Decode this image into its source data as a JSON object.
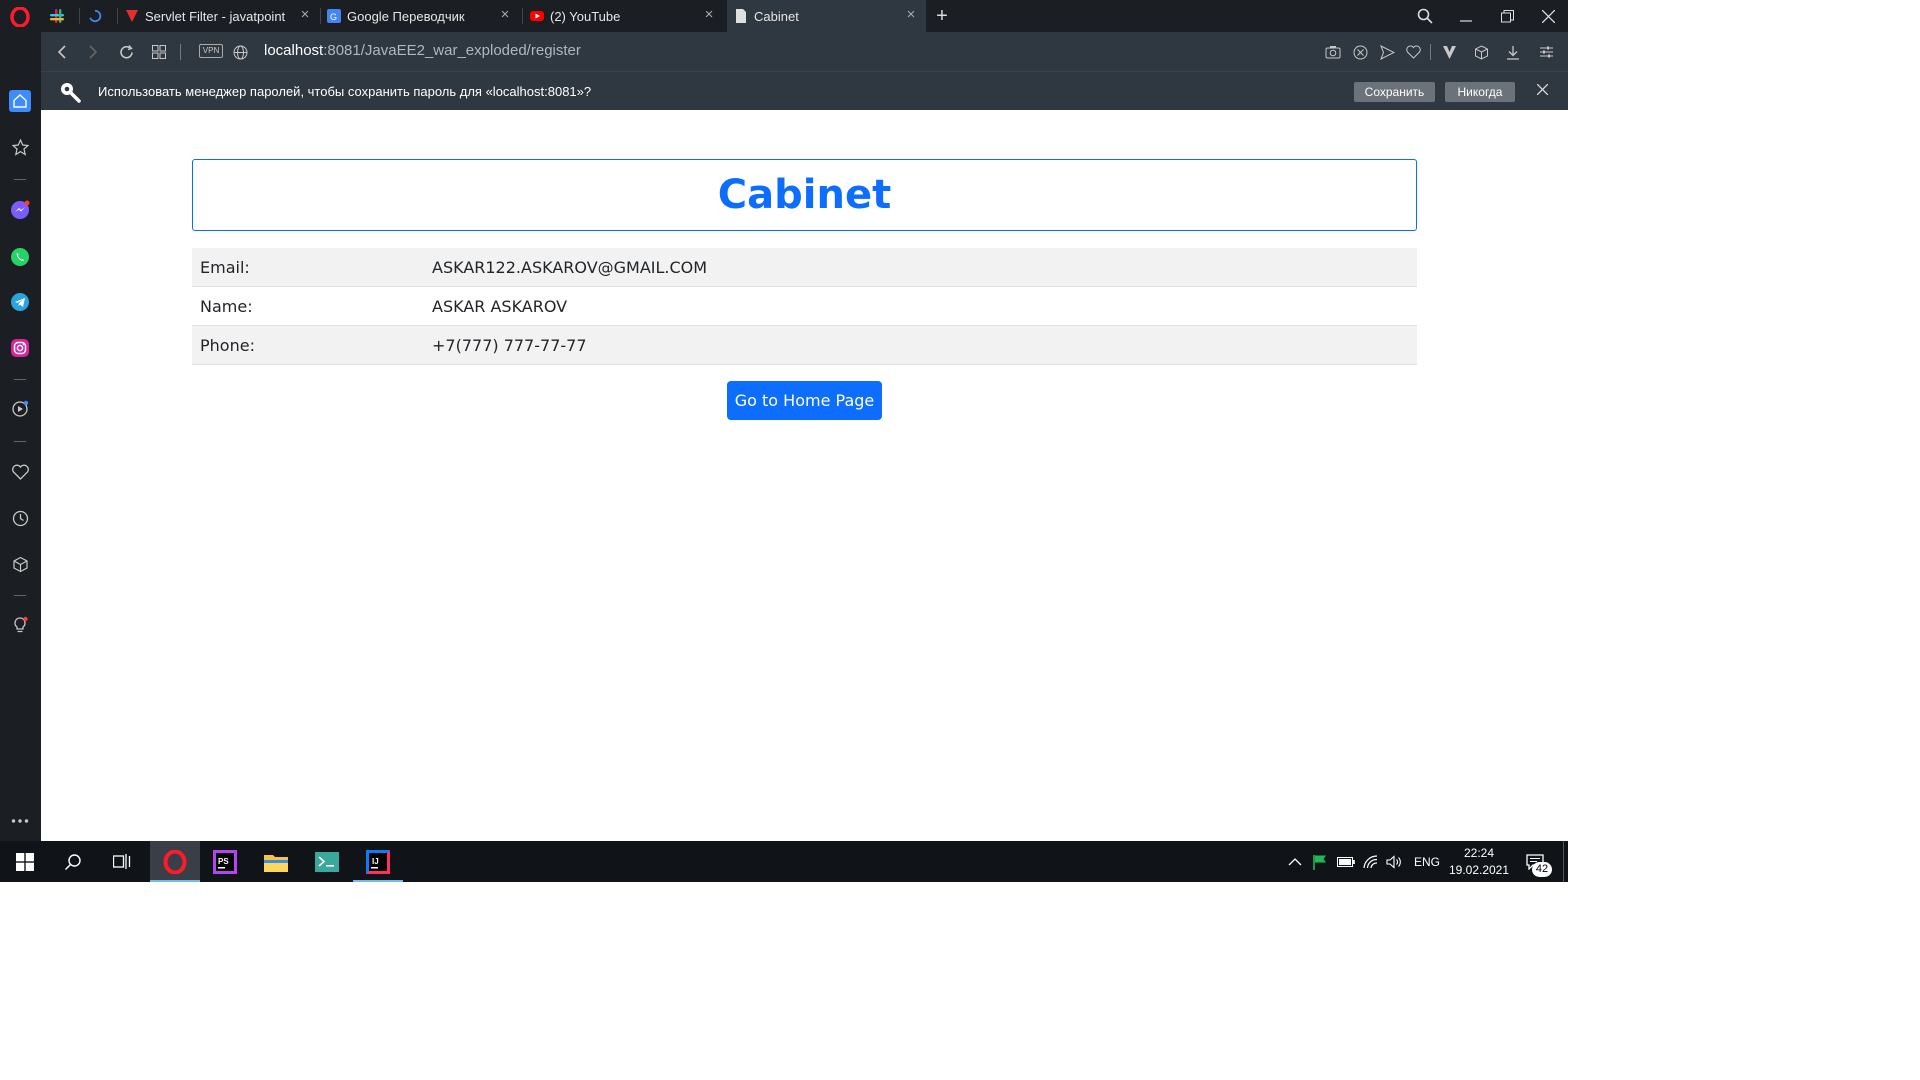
{
  "tabs": [
    {
      "title": "Servlet Filter - javatpoint",
      "icon": "javatpoint-icon"
    },
    {
      "title": "Google Переводчик",
      "icon": "google-translate-icon"
    },
    {
      "title": "(2) YouTube",
      "icon": "youtube-icon"
    },
    {
      "title": "Cabinet",
      "icon": "page-icon",
      "active": true
    }
  ],
  "address": {
    "host": "localhost",
    "rest": ":8081/JavaEE2_war_exploded/register",
    "vpn_label": "VPN"
  },
  "password_bar": {
    "message": "Использовать менеджер паролей, чтобы сохранить пароль для «localhost:8081»?",
    "save_label": "Сохранить",
    "never_label": "Никогда"
  },
  "page": {
    "title": "Cabinet",
    "rows": [
      {
        "label": "Email:",
        "value": "ASKAR122.ASKAROV@GMAIL.COM"
      },
      {
        "label": "Name:",
        "value": "ASKAR ASKAROV"
      },
      {
        "label": "Phone:",
        "value": "+7(777) 777-77-77"
      }
    ],
    "home_button": "Go to Home Page"
  },
  "taskbar": {
    "language": "ENG",
    "time": "22:24",
    "date": "19.02.2021",
    "notifications": "42"
  },
  "colors": {
    "accent": "#0d6efd",
    "opera_red": "#ff1b2d",
    "chrome_dark": "#2f3740"
  }
}
